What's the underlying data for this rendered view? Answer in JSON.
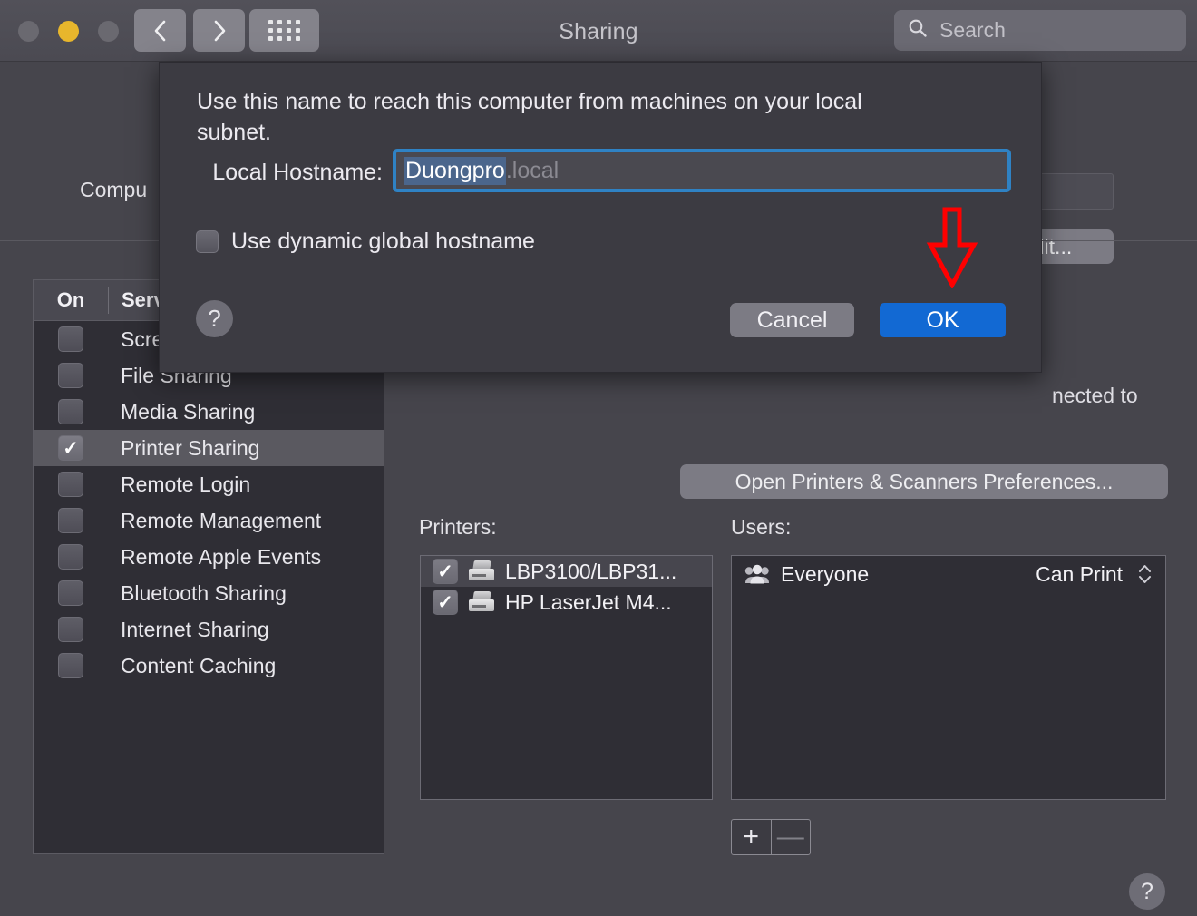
{
  "window": {
    "title": "Sharing",
    "traffic_lights": [
      "close",
      "minimize",
      "zoom"
    ],
    "nav": {
      "back": "back-chevron",
      "forward": "forward-chevron",
      "grid": "show-all-grid"
    },
    "search": {
      "placeholder": "Search",
      "value": "",
      "icon": "search-icon"
    }
  },
  "main": {
    "computer_name_label": "Compu",
    "computer_name_value": "",
    "edit_button": "dit...",
    "connected_text": "nected to",
    "open_prefs_button": "Open Printers & Scanners Preferences...",
    "services_table": {
      "headers": {
        "on": "On",
        "service": "Serv"
      },
      "rows": [
        {
          "label": "Scre",
          "checked": false,
          "selected": false
        },
        {
          "label": "File Sharing",
          "checked": false,
          "selected": false
        },
        {
          "label": "Media Sharing",
          "checked": false,
          "selected": false
        },
        {
          "label": "Printer Sharing",
          "checked": true,
          "selected": true
        },
        {
          "label": "Remote Login",
          "checked": false,
          "selected": false
        },
        {
          "label": "Remote Management",
          "checked": false,
          "selected": false
        },
        {
          "label": "Remote Apple Events",
          "checked": false,
          "selected": false
        },
        {
          "label": "Bluetooth Sharing",
          "checked": false,
          "selected": false
        },
        {
          "label": "Internet Sharing",
          "checked": false,
          "selected": false
        },
        {
          "label": "Content Caching",
          "checked": false,
          "selected": false
        }
      ]
    },
    "printers": {
      "label": "Printers:",
      "rows": [
        {
          "name": "LBP3100/LBP31...",
          "checked": true,
          "selected": true
        },
        {
          "name": "HP LaserJet M4...",
          "checked": true,
          "selected": false
        }
      ]
    },
    "users": {
      "label": "Users:",
      "rows": [
        {
          "name": "Everyone",
          "permission": "Can Print",
          "icon": "group-icon"
        }
      ],
      "add_button": "+",
      "remove_button": "—"
    },
    "help_button": "?"
  },
  "sheet": {
    "description": "Use this name to reach this computer from machines on your local subnet.",
    "hostname_label": "Local Hostname:",
    "hostname_selected": "Duongpro",
    "hostname_suffix": ".local",
    "dynamic_hostname_label": "Use dynamic global hostname",
    "dynamic_hostname_checked": false,
    "help_button": "?",
    "cancel_button": "Cancel",
    "ok_button": "OK"
  },
  "annotation": {
    "arrow": "red-down-arrow",
    "color": "#ff0000",
    "points_at": "OK"
  },
  "colors": {
    "window_bg": "#46454c",
    "titlebar": "#4f4e56",
    "sheet_bg": "#3c3b42",
    "list_bg": "#2f2e35",
    "accent_blue": "#1269d3",
    "focus_ring": "#2f82c4",
    "selection_blue": "#4b668c",
    "annotation_red": "#ff0000"
  }
}
